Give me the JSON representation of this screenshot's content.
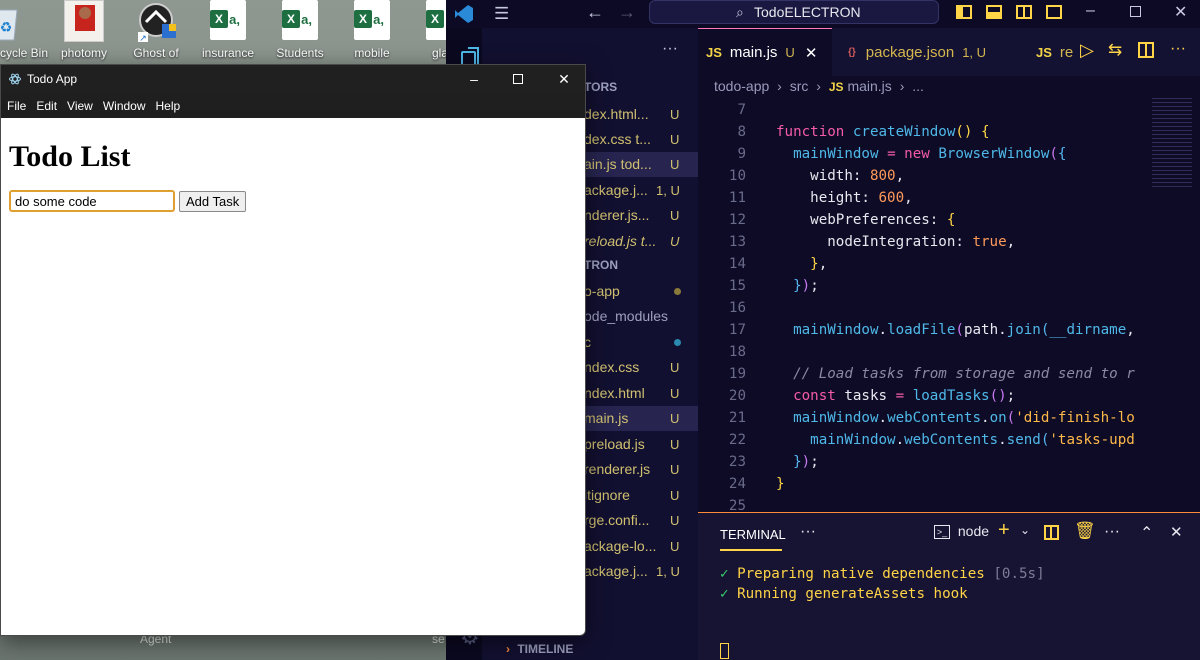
{
  "desktop": {
    "icons": [
      {
        "label": "cycle Bin"
      },
      {
        "label": "photomy"
      },
      {
        "label": "Ghost of"
      },
      {
        "label": "insurance"
      },
      {
        "label": "Students"
      },
      {
        "label": "mobile"
      },
      {
        "label": "gla"
      }
    ],
    "taskbar_labels": [
      "Agent",
      "se"
    ]
  },
  "todo_window": {
    "title": "Todo App",
    "menu": [
      "File",
      "Edit",
      "View",
      "Window",
      "Help"
    ],
    "heading": "Todo List",
    "input_value": "do some code",
    "add_button": "Add Task"
  },
  "vscode": {
    "search_label": "TodoELECTRON",
    "tabs": [
      {
        "icon": "JS",
        "label": "main.js",
        "status": "U"
      },
      {
        "icon": "{}",
        "label": "package.json",
        "status": "1, U"
      },
      {
        "icon": "JS",
        "label": "re"
      }
    ],
    "breadcrumb": [
      "todo-app",
      "src",
      "main.js",
      "..."
    ],
    "editors_header": "TORS",
    "open_editors": [
      {
        "label": "dex.html...",
        "status": "U"
      },
      {
        "label": "dex.css t...",
        "status": "U"
      },
      {
        "label": "ain.js tod...",
        "status": "U"
      },
      {
        "label": "ackage.j...",
        "status": "1, U"
      },
      {
        "label": "nderer.js...",
        "status": "U"
      },
      {
        "label": "reload.js t...",
        "status": "U"
      }
    ],
    "project_header": "TRON",
    "project_items": [
      {
        "label": "o-app",
        "status": ""
      },
      {
        "label": "ode_modules",
        "status": ""
      },
      {
        "label": "c",
        "status": ""
      },
      {
        "label": "ndex.css",
        "status": "U"
      },
      {
        "label": "ndex.html",
        "status": "U"
      },
      {
        "label": "main.js",
        "status": "U"
      },
      {
        "label": "preload.js",
        "status": "U"
      },
      {
        "label": "renderer.js",
        "status": "U"
      },
      {
        "label": "itignore",
        "status": "U"
      },
      {
        "label": "rge.confi...",
        "status": "U"
      },
      {
        "label": "ackage-lo...",
        "status": "U"
      },
      {
        "label": "ackage.j...",
        "status": "1, U"
      }
    ],
    "timeline_label": "TIMELINE",
    "line_numbers": [
      "7",
      "8",
      "9",
      "10",
      "11",
      "12",
      "13",
      "14",
      "15",
      "16",
      "17",
      "18",
      "19",
      "20",
      "21",
      "22",
      "23",
      "24",
      "25"
    ],
    "terminal": {
      "tab": "TERMINAL",
      "shell": "node",
      "lines": [
        {
          "text": "Preparing native dependencies",
          "suffix": "[0.5s]"
        },
        {
          "text": "Running generateAssets hook",
          "suffix": ""
        }
      ]
    },
    "colors": {
      "accent": "#ff7ab5",
      "keyword": "#f55ba8",
      "function": "#4fb8e8",
      "number": "#ff9a5a",
      "string": "#ffb84a",
      "terminal_text": "#ffd447"
    }
  }
}
